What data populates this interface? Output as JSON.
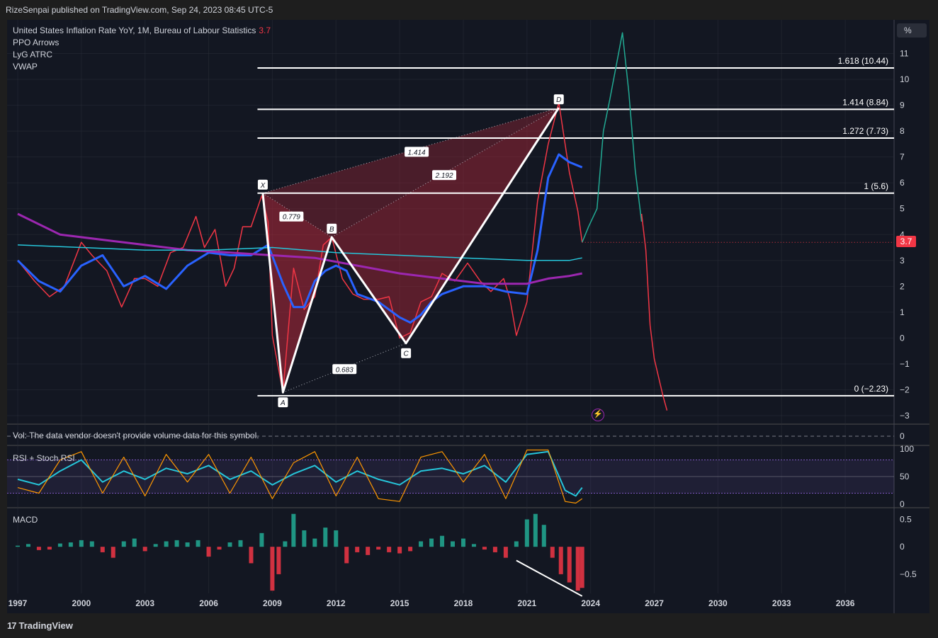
{
  "header": {
    "published": "RizeSenpai published on TradingView.com, Sep 24, 2023 08:45 UTC-5"
  },
  "legend": {
    "symbol": "United States Inflation Rate YoY, 1M, Bureau of Labour Statistics",
    "last_value": "3.7",
    "indicators": [
      "PPO Arrows",
      "LyG ATRC",
      "VWAP"
    ]
  },
  "unit_button": "%",
  "price_tag": "3.7",
  "volume_note": "Vol: The data vendor doesn't provide volume data for this symbol.",
  "branding": "TradingView",
  "colors": {
    "background": "#131722",
    "grid": "#2a2e39",
    "bearish": "#f23645",
    "bullish": "#22ab94",
    "pattern_fill": "#b2283a",
    "vwap": "#9c27b0",
    "ema_fast": "#2962ff",
    "rsi": "#26c6da",
    "stoch": "#ff9800"
  },
  "chart_data": [
    {
      "type": "line",
      "pane": "price",
      "y_ticks": [
        "11",
        "10",
        "9",
        "8",
        "7",
        "6",
        "5",
        "4",
        "3",
        "2",
        "1",
        "0",
        "−1",
        "−2",
        "−3"
      ],
      "x_ticks": [
        "1997",
        "2000",
        "2003",
        "2006",
        "2009",
        "2012",
        "2015",
        "2018",
        "2021",
        "2024",
        "2027",
        "2030",
        "2033",
        "2036"
      ],
      "ylim": [
        -3.3,
        12.3
      ],
      "series": [
        {
          "color": "#f23645",
          "x": [
            1997,
            1997.8,
            1998.5,
            1999.2,
            2000,
            2000.5,
            2001.2,
            2001.9,
            2002.5,
            2003,
            2003.6,
            2004.2,
            2004.8,
            2005.4,
            2005.8,
            2006.3,
            2006.8,
            2007.2,
            2007.6,
            2008,
            2008.5,
            2008.8,
            2009,
            2009.5,
            2010,
            2010.5,
            2011,
            2011.4,
            2011.8,
            2012.3,
            2012.8,
            2013.3,
            2014,
            2014.5,
            2015,
            2015.5,
            2016,
            2016.5,
            2017,
            2017.6,
            2018.2,
            2018.8,
            2019.3,
            2019.9,
            2020.2,
            2020.5,
            2021,
            2021.5,
            2022,
            2022.5,
            2023,
            2023.4,
            2023.6
          ],
          "values": [
            3,
            2.2,
            1.6,
            2,
            3.7,
            3.2,
            2.6,
            1.2,
            2.3,
            2.3,
            2,
            3.3,
            3.5,
            4.7,
            3.5,
            4.2,
            2,
            2.7,
            4.3,
            4.3,
            5.5,
            4.5,
            0.1,
            -2.1,
            2.7,
            1.1,
            1.6,
            3.6,
            3.9,
            2.3,
            1.7,
            1.5,
            1.5,
            1.6,
            0,
            0.2,
            1.4,
            1.6,
            2.5,
            2.2,
            2.9,
            2.2,
            1.8,
            2.3,
            1.5,
            0.1,
            1.4,
            5.3,
            7.5,
            9.1,
            6.4,
            4.9,
            3.7
          ]
        },
        {
          "color": "#22ab94",
          "x": [
            2023.6,
            2023.9,
            2024.3,
            2024.6,
            2024.9,
            2025.2,
            2025.5,
            2025.8,
            2026.1,
            2026.4
          ],
          "values": [
            3.7,
            4.3,
            5,
            8,
            9.2,
            10.5,
            11.8,
            9.5,
            6.5,
            4.5
          ]
        },
        {
          "color": "#f23645",
          "x": [
            2026.4,
            2026.6,
            2026.8,
            2027,
            2027.2,
            2027.4,
            2027.6
          ],
          "values": [
            4.8,
            3.4,
            0.5,
            -0.8,
            -1.5,
            -2.2,
            -2.8
          ]
        },
        {
          "color": "#2962ff",
          "x": [
            1997,
            1998,
            1999,
            2000,
            2001,
            2002,
            2003,
            2004,
            2005,
            2006,
            2007,
            2008,
            2008.8,
            2009.5,
            2010,
            2010.5,
            2011,
            2011.5,
            2012,
            2012.5,
            2013,
            2014,
            2015,
            2015.5,
            2016,
            2016.5,
            2017,
            2018,
            2019,
            2020,
            2021,
            2021.5,
            2022,
            2022.5,
            2023,
            2023.6
          ],
          "values": [
            3,
            2.2,
            1.8,
            2.8,
            3.2,
            2,
            2.4,
            1.9,
            2.8,
            3.3,
            3.2,
            3.2,
            3.6,
            2.1,
            1.2,
            1.2,
            2.2,
            2.6,
            2.8,
            2.6,
            1.7,
            1.4,
            0.8,
            0.6,
            0.9,
            1.4,
            1.7,
            2,
            2,
            1.8,
            1.7,
            3.4,
            6.2,
            7.1,
            6.8,
            6.6
          ]
        },
        {
          "color": "#9c27b0",
          "x": [
            1997,
            1999,
            2001,
            2003,
            2005,
            2007,
            2009,
            2011,
            2013,
            2015,
            2017,
            2019,
            2021,
            2022,
            2023,
            2023.6
          ],
          "values": [
            4.8,
            4,
            3.8,
            3.6,
            3.4,
            3.3,
            3.2,
            3.1,
            2.8,
            2.5,
            2.3,
            2.1,
            2.1,
            2.3,
            2.4,
            2.5
          ]
        },
        {
          "color": "#26c6da",
          "x": [
            1997,
            2000,
            2003,
            2006,
            2009,
            2012,
            2015,
            2018,
            2021,
            2023,
            2023.6
          ],
          "values": [
            3.6,
            3.5,
            3.4,
            3.4,
            3.5,
            3.3,
            3.2,
            3.1,
            3,
            3,
            3.1
          ]
        }
      ],
      "fib_levels": [
        {
          "label": "1.618 (10.44)",
          "value": 10.44
        },
        {
          "label": "1.414 (8.84)",
          "value": 8.84
        },
        {
          "label": "1.272 (7.73)",
          "value": 7.73
        },
        {
          "label": "1 (5.6)",
          "value": 5.6
        },
        {
          "label": "0 (−2.23)",
          "value": -2.23
        }
      ],
      "harmonic_points": [
        {
          "name": "X",
          "x": 2008.55,
          "value": 5.6
        },
        {
          "name": "A",
          "x": 2009.5,
          "value": -2.1
        },
        {
          "name": "B",
          "x": 2011.8,
          "value": 3.9
        },
        {
          "name": "C",
          "x": 2015.3,
          "value": -0.2
        },
        {
          "name": "D",
          "x": 2022.5,
          "value": 8.9
        }
      ],
      "ratios": [
        {
          "label": "0.779",
          "x": 2009.9,
          "value": 4.7
        },
        {
          "label": "1.414",
          "x": 2015.8,
          "value": 7.2
        },
        {
          "label": "2.192",
          "x": 2017.1,
          "value": 6.3
        },
        {
          "label": "0.683",
          "x": 2012.4,
          "value": -1.2
        }
      ]
    },
    {
      "type": "line",
      "pane": "rsi",
      "title": "RSI + Stoch RSI",
      "y_ticks": [
        "100",
        "50",
        "0"
      ],
      "ylim": [
        -5,
        105
      ],
      "series": [
        {
          "color": "#26c6da",
          "x": [
            1997,
            1998,
            1999,
            2000,
            2001,
            2002,
            2003,
            2004,
            2005,
            2006,
            2007,
            2008,
            2009,
            2010,
            2011,
            2012,
            2013,
            2014,
            2015,
            2016,
            2017,
            2018,
            2019,
            2020,
            2021,
            2022,
            2022.8,
            2023.3,
            2023.6
          ],
          "values": [
            45,
            35,
            60,
            80,
            40,
            60,
            45,
            65,
            55,
            70,
            45,
            60,
            35,
            55,
            70,
            40,
            60,
            45,
            35,
            60,
            65,
            55,
            70,
            40,
            90,
            95,
            25,
            15,
            30
          ]
        },
        {
          "color": "#ff9800",
          "x": [
            1997,
            1998,
            1999,
            2000,
            2001,
            2002,
            2003,
            2004,
            2005,
            2006,
            2007,
            2008,
            2009,
            2010,
            2011,
            2012,
            2013,
            2014,
            2015,
            2016,
            2017,
            2018,
            2019,
            2020,
            2021,
            2022,
            2022.8,
            2023.3,
            2023.6
          ],
          "values": [
            30,
            20,
            80,
            95,
            20,
            85,
            15,
            90,
            40,
            90,
            20,
            85,
            10,
            75,
            95,
            15,
            85,
            10,
            5,
            85,
            95,
            40,
            90,
            10,
            98,
            98,
            5,
            2,
            10
          ]
        }
      ]
    },
    {
      "type": "bar",
      "pane": "macd",
      "title": "MACD",
      "y_ticks": [
        "0.5",
        "0",
        "−0.5"
      ],
      "ylim": [
        -0.85,
        0.7
      ],
      "x": [
        1997,
        1997.5,
        1998,
        1998.5,
        1999,
        1999.5,
        2000,
        2000.5,
        2001,
        2001.5,
        2002,
        2002.5,
        2003,
        2003.5,
        2004,
        2004.5,
        2005,
        2005.5,
        2006,
        2006.5,
        2007,
        2007.5,
        2008,
        2008.5,
        2009,
        2009.3,
        2009.6,
        2010,
        2010.5,
        2011,
        2011.5,
        2012,
        2012.5,
        2013,
        2013.5,
        2014,
        2014.5,
        2015,
        2015.5,
        2016,
        2016.5,
        2017,
        2017.5,
        2018,
        2018.5,
        2019,
        2019.5,
        2020,
        2020.5,
        2021,
        2021.4,
        2021.8,
        2022.2,
        2022.6,
        2023,
        2023.4,
        2023.6
      ],
      "values": [
        0.02,
        0.05,
        -0.06,
        -0.05,
        0.06,
        0.08,
        0.12,
        0.1,
        -0.1,
        -0.2,
        0.1,
        0.15,
        -0.08,
        0.05,
        0.1,
        0.12,
        0.08,
        0.12,
        -0.18,
        -0.05,
        0.08,
        0.12,
        -0.3,
        0.25,
        -0.8,
        -0.5,
        0.1,
        0.6,
        0.3,
        0.15,
        0.35,
        0.3,
        -0.3,
        -0.1,
        -0.15,
        -0.05,
        -0.1,
        -0.12,
        -0.08,
        0.1,
        0.15,
        0.2,
        0.1,
        0.15,
        0.05,
        -0.05,
        -0.1,
        -0.2,
        0.1,
        0.5,
        0.6,
        0.4,
        -0.2,
        -0.5,
        -0.65,
        -0.8,
        -0.75
      ],
      "divergence_line": {
        "x": [
          2020.5,
          2023.6
        ],
        "values": [
          -0.25,
          -0.9
        ]
      }
    }
  ]
}
